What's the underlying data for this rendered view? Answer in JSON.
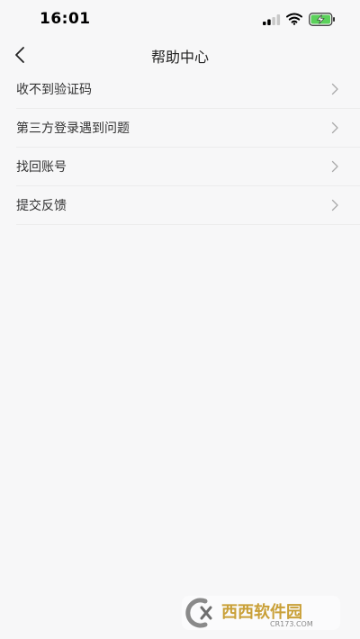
{
  "status_bar": {
    "time": "16:01",
    "icons": [
      "signal-icon",
      "wifi-icon",
      "battery-charging-icon"
    ],
    "battery_color": "#5bd15b"
  },
  "nav": {
    "title": "帮助中心",
    "back_icon": "chevron-left-icon"
  },
  "help_items": [
    {
      "label": "收不到验证码"
    },
    {
      "label": "第三方登录遇到问题"
    },
    {
      "label": "找回账号"
    },
    {
      "label": "提交反馈"
    }
  ],
  "watermark": {
    "brand": "西西软件园",
    "domain": "CR173.COM"
  }
}
